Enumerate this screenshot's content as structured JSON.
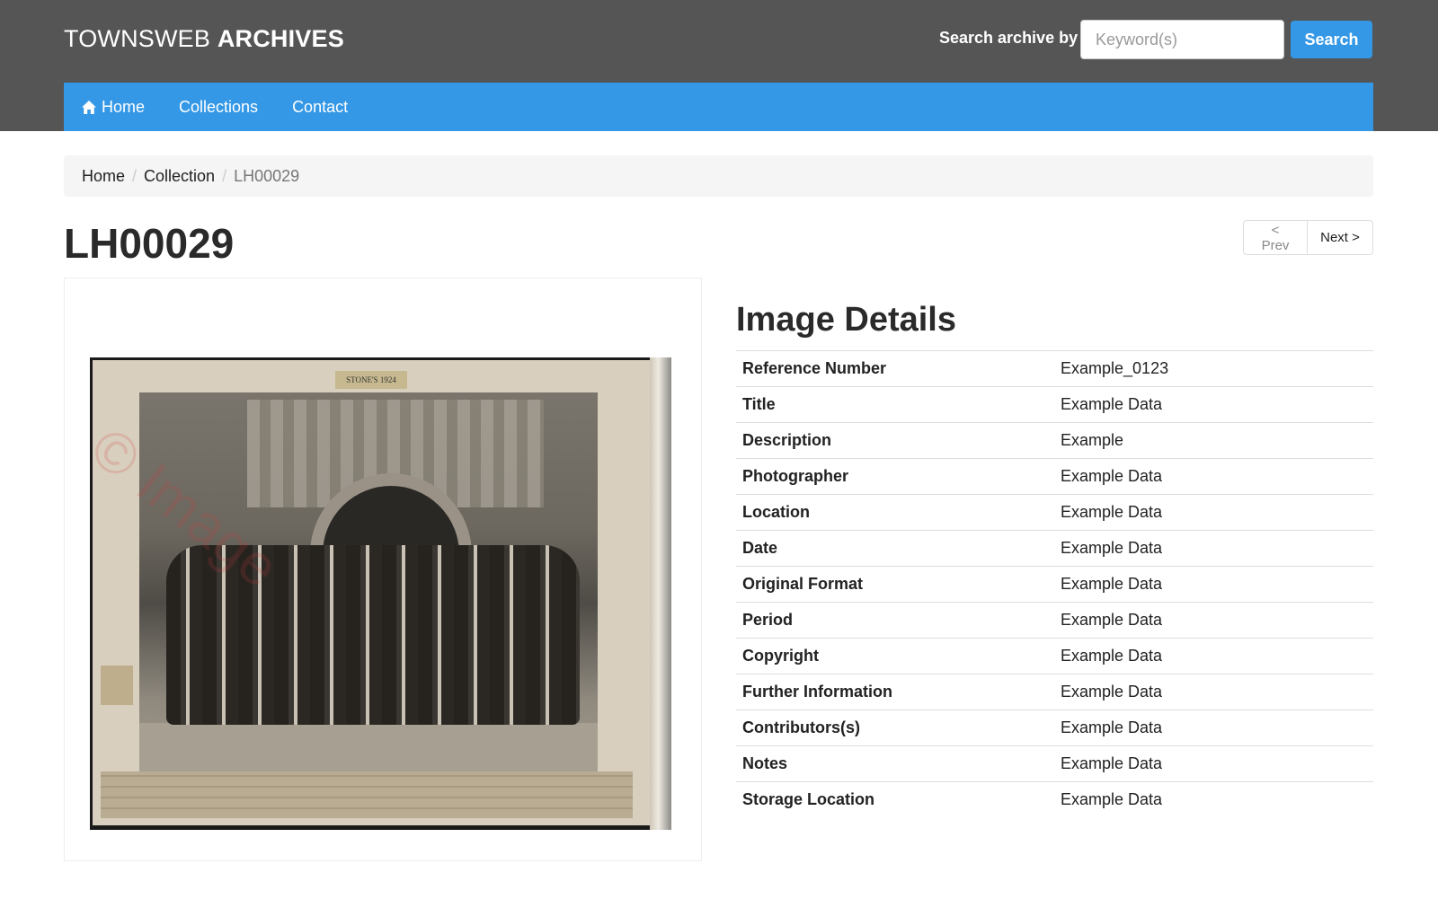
{
  "header": {
    "brand_light": "TOWNSWEB ",
    "brand_bold": "ARCHIVES",
    "search_label": "Search archive by",
    "search_placeholder": "Keyword(s)",
    "search_button": "Search"
  },
  "nav": {
    "items": [
      {
        "label": "Home",
        "icon": "home-icon"
      },
      {
        "label": "Collections"
      },
      {
        "label": "Contact"
      }
    ]
  },
  "breadcrumb": {
    "items": [
      "Home",
      "Collection"
    ],
    "active": "LH00029",
    "separator": "/"
  },
  "page": {
    "title": "LH00029",
    "prev_label": "< Prev",
    "next_label": "Next >"
  },
  "photo": {
    "label": "STONE'S 1924",
    "watermark": "© Image"
  },
  "details": {
    "title": "Image Details",
    "rows": [
      {
        "key": "Reference Number",
        "value": "Example_0123"
      },
      {
        "key": "Title",
        "value": "Example Data"
      },
      {
        "key": "Description",
        "value": "Example"
      },
      {
        "key": "Photographer",
        "value": "Example Data"
      },
      {
        "key": "Location",
        "value": "Example Data"
      },
      {
        "key": "Date",
        "value": "Example Data"
      },
      {
        "key": "Original Format",
        "value": "Example Data"
      },
      {
        "key": "Period",
        "value": "Example Data"
      },
      {
        "key": "Copyright",
        "value": "Example Data"
      },
      {
        "key": "Further Information",
        "value": "Example Data"
      },
      {
        "key": "Contributors(s)",
        "value": "Example Data"
      },
      {
        "key": "Notes",
        "value": "Example Data"
      },
      {
        "key": "Storage Location",
        "value": "Example Data"
      }
    ]
  },
  "colors": {
    "header_bg": "#555555",
    "accent": "#3498e6",
    "breadcrumb_bg": "#f5f5f5"
  }
}
